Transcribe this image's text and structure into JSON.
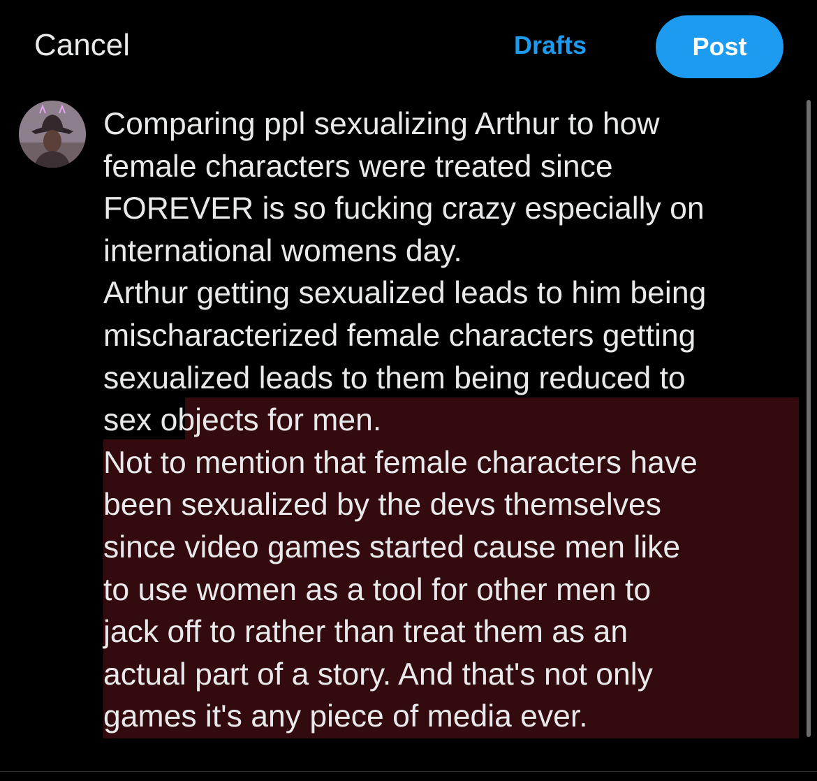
{
  "header": {
    "cancel_label": "Cancel",
    "drafts_label": "Drafts",
    "post_label": "Post"
  },
  "composer": {
    "text": "Comparing ppl sexualizing Arthur to how\nfemale characters were treated since\nFOREVER is so fucking crazy especially on\ninternational womens day.\nArthur getting sexualized leads to him being\nmischaracterized female characters getting\nsexualized leads to them being reduced to\nsex objects for men.\nNot to mention that female characters have\nbeen sexualized by the devs themselves\nsince video games started cause men like\nto use women as a tool for other men to\njack off to rather than treat them as an\nactual part of a story. And that's not only\ngames it's any piece of media ever."
  },
  "colors": {
    "background": "#000000",
    "accent": "#1d9bf0",
    "text": "#e7e9ea",
    "highlight": "#330a0d"
  }
}
